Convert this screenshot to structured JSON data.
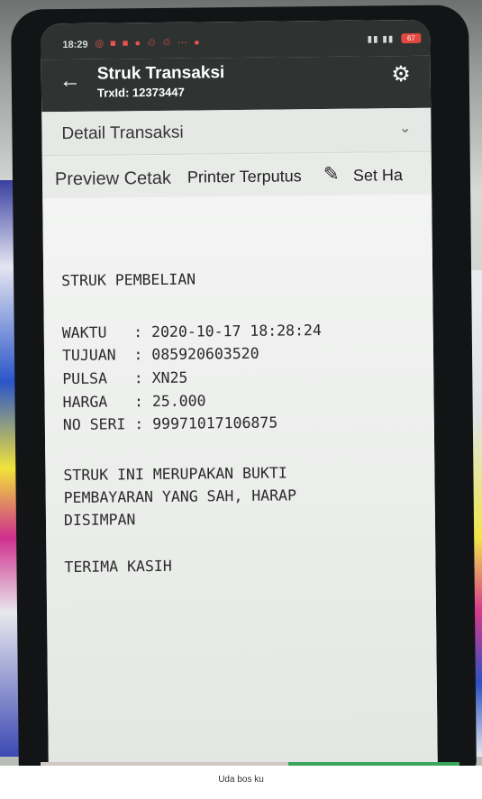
{
  "statusbar": {
    "time": "18:29",
    "notifications": "◎ ■ ■ ● ♲ ♲ ⋯ ●",
    "signal": "▮▮ ▮▮",
    "battery": "67"
  },
  "appbar": {
    "title": "Struk Transaksi",
    "subtitle": "TrxId: 12373447"
  },
  "dropdown": {
    "label": "Detail Transaksi"
  },
  "toolbar": {
    "preview": "Preview Cetak",
    "printer_status": "Printer Terputus",
    "set": "Set Ha"
  },
  "receipt": {
    "heading": "STRUK PEMBELIAN",
    "rows": [
      "WAKTU   : 2020-10-17 18:28:24",
      "TUJUAN  : 085920603520",
      "PULSA   : XN25",
      "HARGA   : 25.000",
      "NO SERI : 99971017106875"
    ],
    "note": [
      "STRUK INI MERUPAKAN BUKTI",
      "PEMBAYARAN YANG SAH, HARAP",
      "DISIMPAN"
    ],
    "closing": "TERIMA KASIH"
  },
  "caption": "Uda bos ku",
  "colors": {
    "appbar": "#2f3432",
    "screen_bg": "#eef0ee",
    "battery": "#e0493f"
  },
  "icons": [
    "back-arrow-icon",
    "gear-icon",
    "chevron-down-icon",
    "pencil-icon"
  ]
}
